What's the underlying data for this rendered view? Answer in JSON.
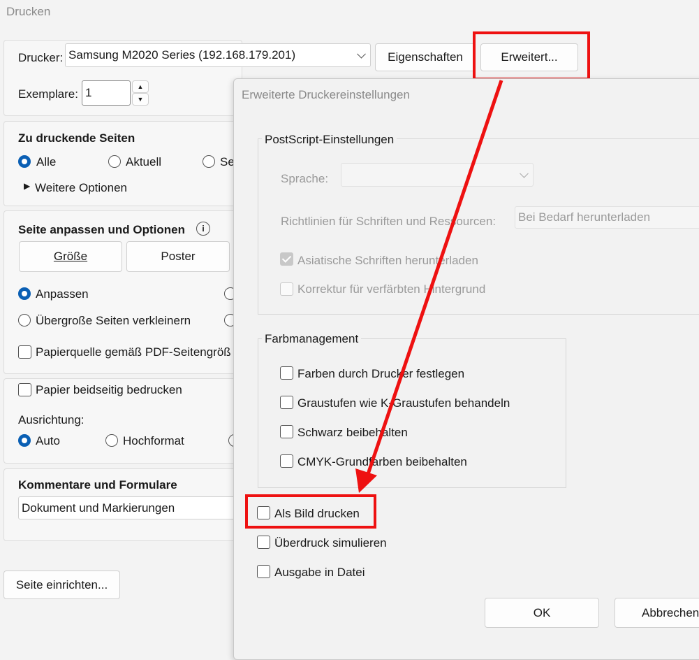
{
  "window": {
    "title": "Drucken"
  },
  "printer": {
    "label": "Drucker:",
    "selected": "Samsung M2020 Series (192.168.179.201)",
    "properties_button": "Eigenschaften",
    "advanced_button": "Erweitert..."
  },
  "copies": {
    "label": "Exemplare:",
    "value": "1"
  },
  "pages": {
    "heading": "Zu druckende Seiten",
    "options": [
      "Alle",
      "Aktuell",
      "Se"
    ],
    "selected": "Alle",
    "more_options": "Weitere Optionen"
  },
  "sizing": {
    "heading": "Seite anpassen und Optionen",
    "size_button": "Größe",
    "poster_button": "Poster",
    "fit": "Anpassen",
    "shrink": "Übergroße Seiten verkleinern",
    "paper_source": "Papierquelle gemäß PDF-Seitengröß"
  },
  "duplex": {
    "checkbox": "Papier beidseitig bedrucken",
    "orientation_label": "Ausrichtung:",
    "auto": "Auto",
    "portrait": "Hochformat"
  },
  "comments": {
    "heading": "Kommentare und Formulare",
    "selected": "Dokument und Markierungen"
  },
  "page_setup_button": "Seite einrichten...",
  "advanced_dialog": {
    "title": "Erweiterte Druckereinstellungen",
    "postscript": {
      "legend": "PostScript-Einstellungen",
      "language_label": "Sprache:",
      "language_value": "",
      "font_policy_label": "Richtlinien für Schriften und Ressourcen:",
      "font_policy_value": "Bei Bedarf herunterladen",
      "asian_fonts": "Asiatische Schriften herunterladen",
      "discolored_bg": "Korrektur für verfärbten Hintergrund"
    },
    "color": {
      "legend": "Farbmanagement",
      "printer_colors": "Farben durch Drucker festlegen",
      "grayscale_k": "Graustufen wie K-Graustufen behandeln",
      "keep_black": "Schwarz beibehalten",
      "keep_cmyk": "CMYK-Grundfarben beibehalten"
    },
    "print_as_image": "Als Bild drucken",
    "simulate_overprint": "Überdruck simulieren",
    "output_to_file": "Ausgabe in Datei",
    "ok_button": "OK",
    "cancel_button": "Abbrechen"
  },
  "colors": {
    "accent": "#0a5fb4",
    "highlight": "#ee1111"
  }
}
